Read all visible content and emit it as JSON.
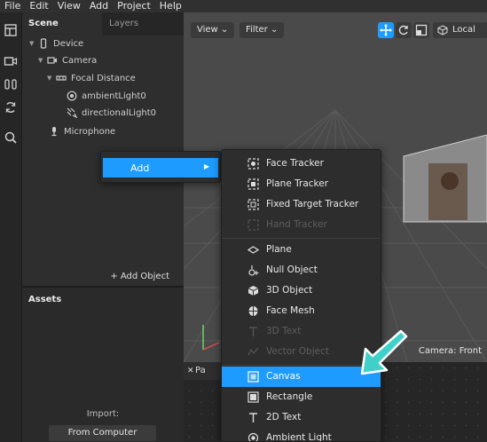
{
  "menubar": {
    "items": [
      "File",
      "Edit",
      "View",
      "Add",
      "Project",
      "Help"
    ]
  },
  "scene_panel": {
    "tabs": {
      "scene": "Scene",
      "layers": "Layers"
    },
    "tree": [
      {
        "label": "Device",
        "icon": "device-icon"
      },
      {
        "label": "Camera",
        "icon": "camera-icon"
      },
      {
        "label": "Focal Distance",
        "icon": "focal-distance-icon"
      },
      {
        "label": "ambientLight0",
        "icon": "ambient-light-icon"
      },
      {
        "label": "directionalLight0",
        "icon": "directional-light-icon"
      },
      {
        "label": "Microphone",
        "icon": "microphone-icon"
      }
    ],
    "add_object": "+ Add Object"
  },
  "assets_panel": {
    "title": "Assets",
    "import_label": "Import:",
    "from_computer": "From Computer"
  },
  "viewport": {
    "view_btn": "View",
    "filter_btn": "Filter",
    "local_btn": "Local",
    "camera_label": "Camera: Front"
  },
  "patch_panel": {
    "tab_label": "Pa"
  },
  "context_menu": {
    "add_label": "Add"
  },
  "add_submenu": {
    "groups": [
      [
        {
          "label": "Face Tracker",
          "icon": "face-tracker-icon",
          "enabled": true
        },
        {
          "label": "Plane Tracker",
          "icon": "plane-tracker-icon",
          "enabled": true
        },
        {
          "label": "Fixed Target Tracker",
          "icon": "fixed-target-tracker-icon",
          "enabled": true
        },
        {
          "label": "Hand Tracker",
          "icon": "hand-tracker-icon",
          "enabled": false
        }
      ],
      [
        {
          "label": "Plane",
          "icon": "plane-icon",
          "enabled": true
        },
        {
          "label": "Null Object",
          "icon": "null-object-icon",
          "enabled": true
        },
        {
          "label": "3D Object",
          "icon": "3d-object-icon",
          "enabled": true
        },
        {
          "label": "Face Mesh",
          "icon": "face-mesh-icon",
          "enabled": true
        },
        {
          "label": "3D Text",
          "icon": "3d-text-icon",
          "enabled": false
        },
        {
          "label": "Vector Object",
          "icon": "vector-object-icon",
          "enabled": false
        }
      ],
      [
        {
          "label": "Canvas",
          "icon": "canvas-icon",
          "enabled": true,
          "highlighted": true
        },
        {
          "label": "Rectangle",
          "icon": "rectangle-icon",
          "enabled": true
        },
        {
          "label": "2D Text",
          "icon": "2d-text-icon",
          "enabled": true
        },
        {
          "label": "Ambient Light",
          "icon": "ambient-light-icon",
          "enabled": true
        }
      ]
    ]
  },
  "colors": {
    "accent": "#1e9bff",
    "pointer": "#3fd1c9"
  }
}
